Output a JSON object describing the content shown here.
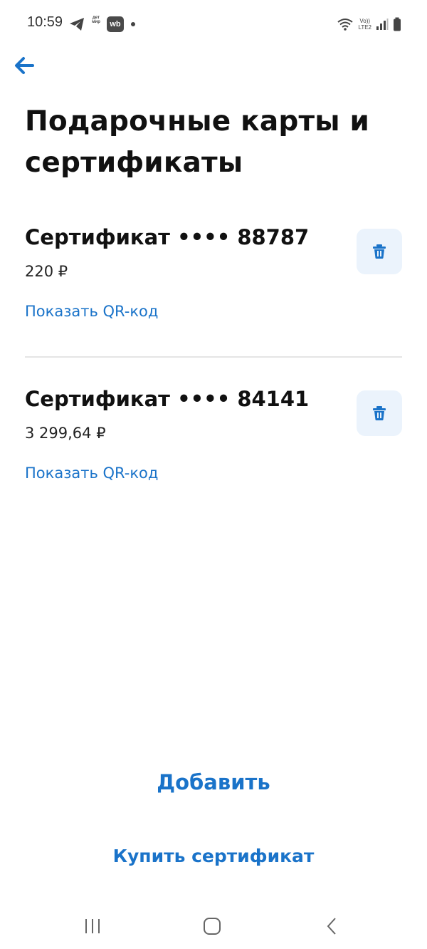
{
  "status_bar": {
    "time": "10:59",
    "detmir_label": "дет мир",
    "wb_label": "wb",
    "net_label_top": "Vo))",
    "net_label_bottom": "LTE2"
  },
  "header": {
    "back_icon": "arrow-left-icon",
    "title": "Подарочные карты и сертификаты"
  },
  "certificates": [
    {
      "title": "Сертификат •••• 88787",
      "amount": "220 ₽",
      "qr_link": "Показать QR-код",
      "delete_icon": "trash-icon"
    },
    {
      "title": "Сертификат •••• 84141",
      "amount": "3 299,64 ₽",
      "qr_link": "Показать QR-код",
      "delete_icon": "trash-icon"
    }
  ],
  "actions": {
    "add_label": "Добавить",
    "buy_label": "Купить сертификат"
  },
  "colors": {
    "accent": "#1a73c9",
    "delete_bg": "#ebf3fc",
    "divider": "#e5e5e5",
    "text": "#111111"
  }
}
